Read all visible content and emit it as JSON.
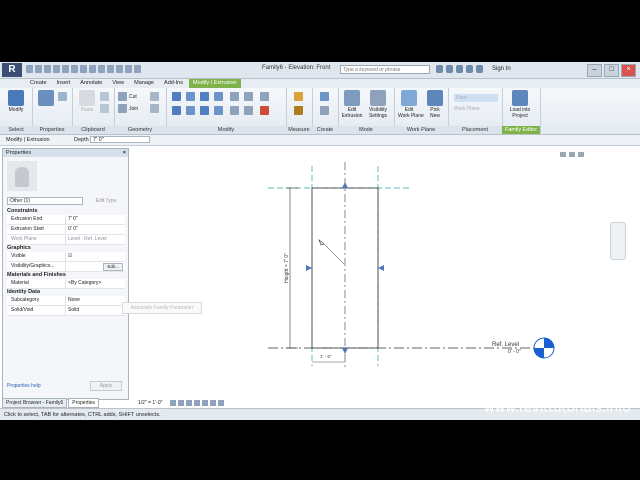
{
  "app": {
    "title": "Family6 - Elevation: Front",
    "logo": "R",
    "search_placeholder": "Type a keyword or phrase",
    "sign_in": "Sign In"
  },
  "tabs": [
    "Create",
    "Insert",
    "Annotate",
    "View",
    "Manage",
    "Add-Ins",
    "Modify | Extrusion"
  ],
  "ribbon": {
    "modify": "Modify",
    "select_panel": "Select",
    "properties_panel": "Properties",
    "clipboard_panel": "Clipboard",
    "paste": "Paste",
    "geometry_panel": "Geometry",
    "cut": "Cut",
    "join": "Join",
    "modify_panel": "Modify",
    "measure_panel": "Measure",
    "create_panel": "Create",
    "mode_panel": "Mode",
    "edit_extrusion": "Edit\nExtrusion",
    "visibility_settings": "Visibility\nSettings",
    "work_plane_panel": "Work Plane",
    "edit_work_plane": "Edit\nWork Plane",
    "pick_new": "Pick\nNew",
    "placement_panel": "Placement",
    "face": "Face",
    "work_plane": "Work Plane",
    "family_editor_panel": "Family Editor",
    "load_into_project": "Load into\nProject"
  },
  "options_bar": {
    "context": "Modify | Extrusion",
    "depth_label": "Depth",
    "depth_value": "7' 0\""
  },
  "properties": {
    "title": "Properties",
    "filter": "Other (1)",
    "edit_type": "Edit Type",
    "groups": {
      "constraints": "Constraints",
      "graphics": "Graphics",
      "materials": "Materials and Finishes",
      "identity": "Identity Data"
    },
    "rows": {
      "extrusion_end_k": "Extrusion End",
      "extrusion_end_v": "7' 0\"",
      "extrusion_start_k": "Extrusion Start",
      "extrusion_start_v": "0' 0\"",
      "work_plane_k": "Work Plane",
      "work_plane_v": "Level : Ref. Level",
      "visible_k": "Visible",
      "visible_v": "☑",
      "vis_graphics_k": "Visibility/Graphics...",
      "vis_graphics_btn": "Edit...",
      "material_k": "Material",
      "material_v": "<By Category>",
      "subcategory_k": "Subcategory",
      "subcategory_v": "None",
      "solid_void_k": "Solid/Void",
      "solid_void_v": "Solid"
    },
    "help": "Properties help",
    "apply": "Apply",
    "tooltip": "Associate Family Parameter"
  },
  "browser_tabs": [
    "Project Browser - Family6",
    "Properties"
  ],
  "drawing": {
    "height_label": "Height = 7' 0\"",
    "width_dim": "1' - 6\"",
    "ref_level": "Ref. Level",
    "ref_level_elev": "0' - 0\""
  },
  "view_bar": {
    "scale": "1/2\" = 1'-0\""
  },
  "status": "Click to select, TAB for alternates, CTRL adds, SHIFT unselects.",
  "watermark": "www.revittutorials.info",
  "colors": {
    "accent": "#7fb34a",
    "app_blue": "#3a4f73",
    "level_marker": "#1a5fd1"
  }
}
